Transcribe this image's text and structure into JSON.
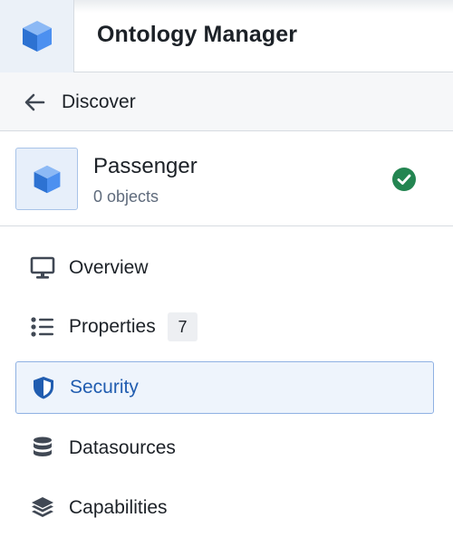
{
  "header": {
    "title": "Ontology Manager",
    "logo_icon": "cube-icon",
    "logo_color": "#2d72d2"
  },
  "back": {
    "label": "Discover",
    "icon": "arrow-left-icon"
  },
  "object": {
    "name": "Passenger",
    "count_text": "0 objects",
    "icon": "cube-icon",
    "status_icon": "check-circle-icon",
    "status_color": "#238551"
  },
  "nav": {
    "items": [
      {
        "id": "overview",
        "label": "Overview",
        "icon": "desktop-icon",
        "active": false
      },
      {
        "id": "properties",
        "label": "Properties",
        "icon": "list-icon",
        "badge": "7",
        "active": false
      },
      {
        "id": "security",
        "label": "Security",
        "icon": "shield-icon",
        "active": true
      },
      {
        "id": "datasources",
        "label": "Datasources",
        "icon": "database-icon",
        "active": false
      },
      {
        "id": "capabilities",
        "label": "Capabilities",
        "icon": "layers-icon",
        "active": false
      }
    ]
  },
  "colors": {
    "accent": "#215db0",
    "icon_gray": "#404854",
    "border": "#d6dbe1"
  }
}
